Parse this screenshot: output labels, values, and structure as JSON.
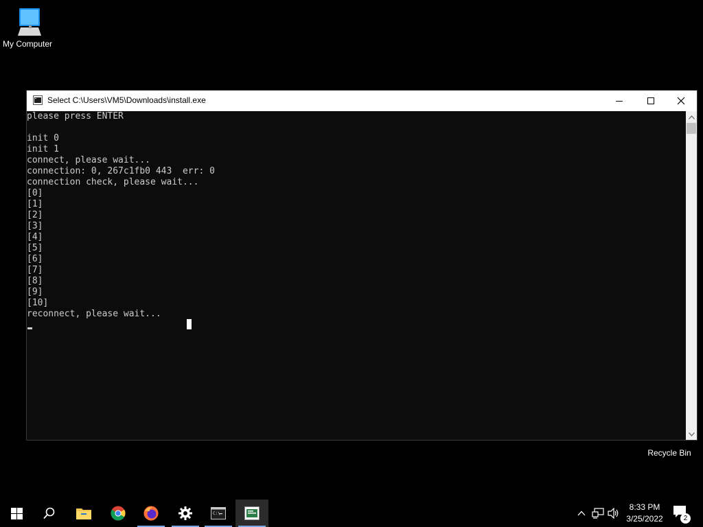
{
  "desktop": {
    "icons": [
      {
        "label": "My Computer",
        "icon": "computer-icon"
      },
      {
        "label": "Recycle Bin",
        "icon": "recycle-bin-icon"
      }
    ]
  },
  "console": {
    "title": "Select C:\\Users\\VM5\\Downloads\\install.exe",
    "icon": "console-app-icon",
    "background": "#0c0c0c",
    "text_color": "#cccccc",
    "lines": [
      "please press ENTER",
      "",
      "init 0",
      "init 1",
      "connect, please wait...",
      "connection: 0, 267c1fb0 443  err: 0",
      "connection check, please wait...",
      "[0]",
      "[1]",
      "[2]",
      "[3]",
      "[4]",
      "[5]",
      "[6]",
      "[7]",
      "[8]",
      "[9]",
      "[10]",
      "reconnect, please wait..."
    ]
  },
  "taskbar": {
    "items": [
      {
        "name": "start-button",
        "icon": "windows-logo-icon"
      },
      {
        "name": "search-button",
        "icon": "search-icon"
      },
      {
        "name": "file-explorer-button",
        "icon": "folder-icon"
      },
      {
        "name": "chrome-button",
        "icon": "chrome-icon"
      },
      {
        "name": "firefox-button",
        "icon": "firefox-icon"
      },
      {
        "name": "settings-button",
        "icon": "gear-icon"
      },
      {
        "name": "cmd-button",
        "icon": "terminal-icon"
      },
      {
        "name": "console-app-button",
        "icon": "console-app-icon"
      }
    ],
    "tray": {
      "time": "8:33 PM",
      "date": "3/25/2022",
      "notifications": "2"
    }
  }
}
